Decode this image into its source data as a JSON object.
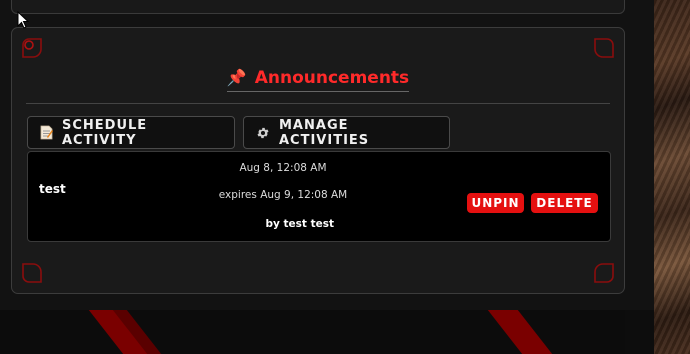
{
  "announcements": {
    "title": "Announcements",
    "pin_icon": "pushpin-icon"
  },
  "actions": {
    "schedule_label": "SCHEDULE ACTIVITY",
    "schedule_icon": "memo-icon",
    "manage_label": "MANAGE ACTIVITIES",
    "manage_icon": "gear-icon"
  },
  "items": [
    {
      "title": "test",
      "date": "Aug 8, 12:08 AM",
      "expires": "expires Aug 9, 12:08 AM",
      "author": "by test test",
      "unpin_label": "UNPIN",
      "delete_label": "DELETE"
    }
  ],
  "colors": {
    "accent": "#ff2a2a",
    "button_red": "#e51010",
    "background": "#121212",
    "card": "#1a1a1a"
  }
}
